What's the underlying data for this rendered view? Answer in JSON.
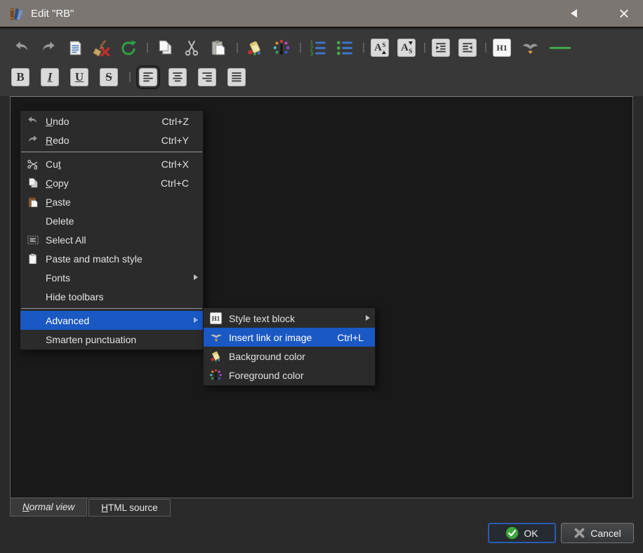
{
  "window": {
    "title": "Edit \"RB\""
  },
  "titlebar": {
    "close_glyph": "×"
  },
  "glyphs": {
    "bold": "B",
    "italic": "I",
    "underline": "U",
    "strikethrough": "S",
    "h1": "H1"
  },
  "toolbar_main": {
    "icons": [
      "undo-icon",
      "redo-icon",
      "document-text-icon",
      "clear-formatting-icon",
      "smarten-punctuation-icon",
      "copy-icon",
      "cut-icon",
      "paste-icon",
      "background-color-icon",
      "foreground-color-icon",
      "ordered-list-icon",
      "unordered-list-icon",
      "superscript-icon",
      "subscript-icon",
      "indent-more-icon",
      "indent-less-icon",
      "style-text-block-icon",
      "insert-link-icon",
      "horizontal-rule-icon"
    ]
  },
  "toolbar_format": {
    "icons": [
      "bold-icon",
      "italic-icon",
      "underline-icon",
      "strikethrough-icon",
      "align-left-icon",
      "align-center-icon",
      "align-right-icon",
      "align-justify-icon"
    ],
    "selected": "align-left-icon"
  },
  "edit_menu": {
    "items": [
      {
        "pre": "",
        "accel": "U",
        "post": "ndo",
        "shortcut": "Ctrl+Z",
        "icon": "undo-icon"
      },
      {
        "pre": "",
        "accel": "R",
        "post": "edo",
        "shortcut": "Ctrl+Y",
        "icon": "redo-icon"
      },
      {
        "pre": "Cu",
        "accel": "t",
        "post": "",
        "shortcut": "Ctrl+X",
        "icon": "cut-icon"
      },
      {
        "pre": "",
        "accel": "C",
        "post": "opy",
        "shortcut": "Ctrl+C",
        "icon": "copy-icon"
      },
      {
        "pre": "",
        "accel": "P",
        "post": "aste",
        "shortcut": "",
        "icon": "paste-icon"
      },
      {
        "pre": "Delete",
        "accel": "",
        "post": "",
        "shortcut": ""
      },
      {
        "pre": "Select All",
        "accel": "",
        "post": "",
        "shortcut": "",
        "icon": "select-all-icon"
      },
      {
        "pre": "Paste and match style",
        "accel": "",
        "post": "",
        "shortcut": "",
        "icon": "paste-match-style-icon"
      },
      {
        "pre": "Fonts",
        "accel": "",
        "post": "",
        "shortcut": "",
        "has_submenu": true
      },
      {
        "pre": "Hide toolbars",
        "accel": "",
        "post": "",
        "shortcut": ""
      },
      {
        "pre": "Advanced",
        "accel": "",
        "post": "",
        "shortcut": "",
        "has_submenu": true,
        "highlighted": true
      },
      {
        "pre": "Smarten punctuation",
        "accel": "",
        "post": "",
        "shortcut": ""
      }
    ]
  },
  "advanced_submenu": {
    "items": [
      {
        "label": "Style text block",
        "shortcut": "",
        "icon": "style-text-block-icon",
        "has_submenu": true
      },
      {
        "label": "Insert link or image",
        "shortcut": "Ctrl+L",
        "icon": "insert-link-icon",
        "highlighted": true
      },
      {
        "label": "Background color",
        "shortcut": "",
        "icon": "background-color-icon"
      },
      {
        "label": "Foreground color",
        "shortcut": "",
        "icon": "foreground-color-icon"
      }
    ]
  },
  "tabs": [
    {
      "accel": "N",
      "rest": "ormal view",
      "active": true
    },
    {
      "accel": "H",
      "rest": "TML source",
      "active": false
    }
  ],
  "footer": {
    "ok_label": "OK",
    "cancel_label": "Cancel"
  },
  "colors": {
    "menu_highlight": "#1a58c4",
    "titlebar_bg": "#7b7672",
    "toolbar_bg": "#383838",
    "content_bg": "#191919",
    "menu_bg": "#2b2b2b",
    "ok_border": "#2c5cae",
    "accent_green": "#3fae49",
    "list_blue": "#3f74c8"
  }
}
